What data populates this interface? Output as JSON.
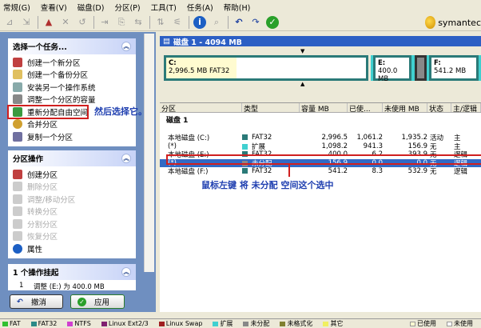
{
  "menu": [
    "常规(G)",
    "查看(V)",
    "磁盘(D)",
    "分区(P)",
    "工具(T)",
    "任务(A)",
    "帮助(H)"
  ],
  "logo": "symantec",
  "tasks": {
    "title": "选择一个任务...",
    "items": [
      "创建一个新分区",
      "创建一个备份分区",
      "安装另一个操作系统",
      "调整一个分区的容量",
      "重新分配自由空间",
      "合并分区",
      "复制一个分区"
    ]
  },
  "annotation_select": "然后选择它。",
  "partition_ops": {
    "title": "分区操作",
    "items": [
      {
        "label": "创建分区",
        "enabled": true
      },
      {
        "label": "删除分区",
        "enabled": false
      },
      {
        "label": "调整/移动分区",
        "enabled": false
      },
      {
        "label": "转换分区",
        "enabled": false
      },
      {
        "label": "分割分区",
        "enabled": false
      },
      {
        "label": "恢复分区",
        "enabled": false
      },
      {
        "label": "属性",
        "enabled": true
      }
    ]
  },
  "pending": {
    "title": "1 个操作挂起",
    "item_no": "1",
    "item": "调整  (E:) 为 400.0 MB"
  },
  "buttons": {
    "undo": "撤消",
    "apply": "应用"
  },
  "disk": {
    "title": "磁盘 1 - 4094 MB",
    "c_label": "C:",
    "c_info": "2,996.5 MB   FAT32",
    "e_label": "E:",
    "e_info": "400.0 MB",
    "f_label": "F:",
    "f_info": "541.2 MB"
  },
  "list": {
    "headers": [
      "分区",
      "类型",
      "容量 MB",
      "已使...",
      "未使用 MB",
      "状态",
      "主/逻辑"
    ],
    "group": "磁盘 1",
    "rows": [
      {
        "name": "本地磁盘 (C:)",
        "type": "FAT32",
        "color": "#2b7a78",
        "size": "2,996.5",
        "used": "1,061.2",
        "free": "1,935.2",
        "status": "活动",
        "kind": "主"
      },
      {
        "name": "(*)",
        "type": "扩展",
        "color": "#40d0d0",
        "size": "1,098.2",
        "used": "941.3",
        "free": "156.9",
        "status": "无",
        "kind": "主"
      },
      {
        "name": "本地磁盘 (E:)",
        "type": "FAT32",
        "color": "#2b7a78",
        "size": "400.0",
        "used": "6.2",
        "free": "393.9",
        "status": "无",
        "kind": "逻辑"
      },
      {
        "name": "(*)",
        "type": "未分配",
        "color": "#888888",
        "size": "156.9",
        "used": "0.0",
        "free": "0.0",
        "status": "无",
        "kind": "逻辑"
      },
      {
        "name": "本地磁盘 (F:)",
        "type": "FAT32",
        "color": "#2b7a78",
        "size": "541.2",
        "used": "8.3",
        "free": "532.9",
        "status": "无",
        "kind": "逻辑"
      }
    ]
  },
  "annotation_list": "鼠标左键 将 未分配 空间这个选中",
  "legend": [
    {
      "label": "FAT",
      "color": "#30c030"
    },
    {
      "label": "FAT32",
      "color": "#2b8a88"
    },
    {
      "label": "NTFS",
      "color": "#d040d0"
    },
    {
      "label": "Linux Ext2/3",
      "color": "#802070"
    },
    {
      "label": "Linux Swap",
      "color": "#a02020"
    },
    {
      "label": "扩展",
      "color": "#40d0d0"
    },
    {
      "label": "未分配",
      "color": "#888888"
    },
    {
      "label": "未格式化",
      "color": "#808030"
    },
    {
      "label": "其它",
      "color": "#f0f060"
    },
    {
      "label": "已使用",
      "color": "#fffbd0"
    },
    {
      "label": "未使用",
      "color": "#ffffff"
    }
  ]
}
